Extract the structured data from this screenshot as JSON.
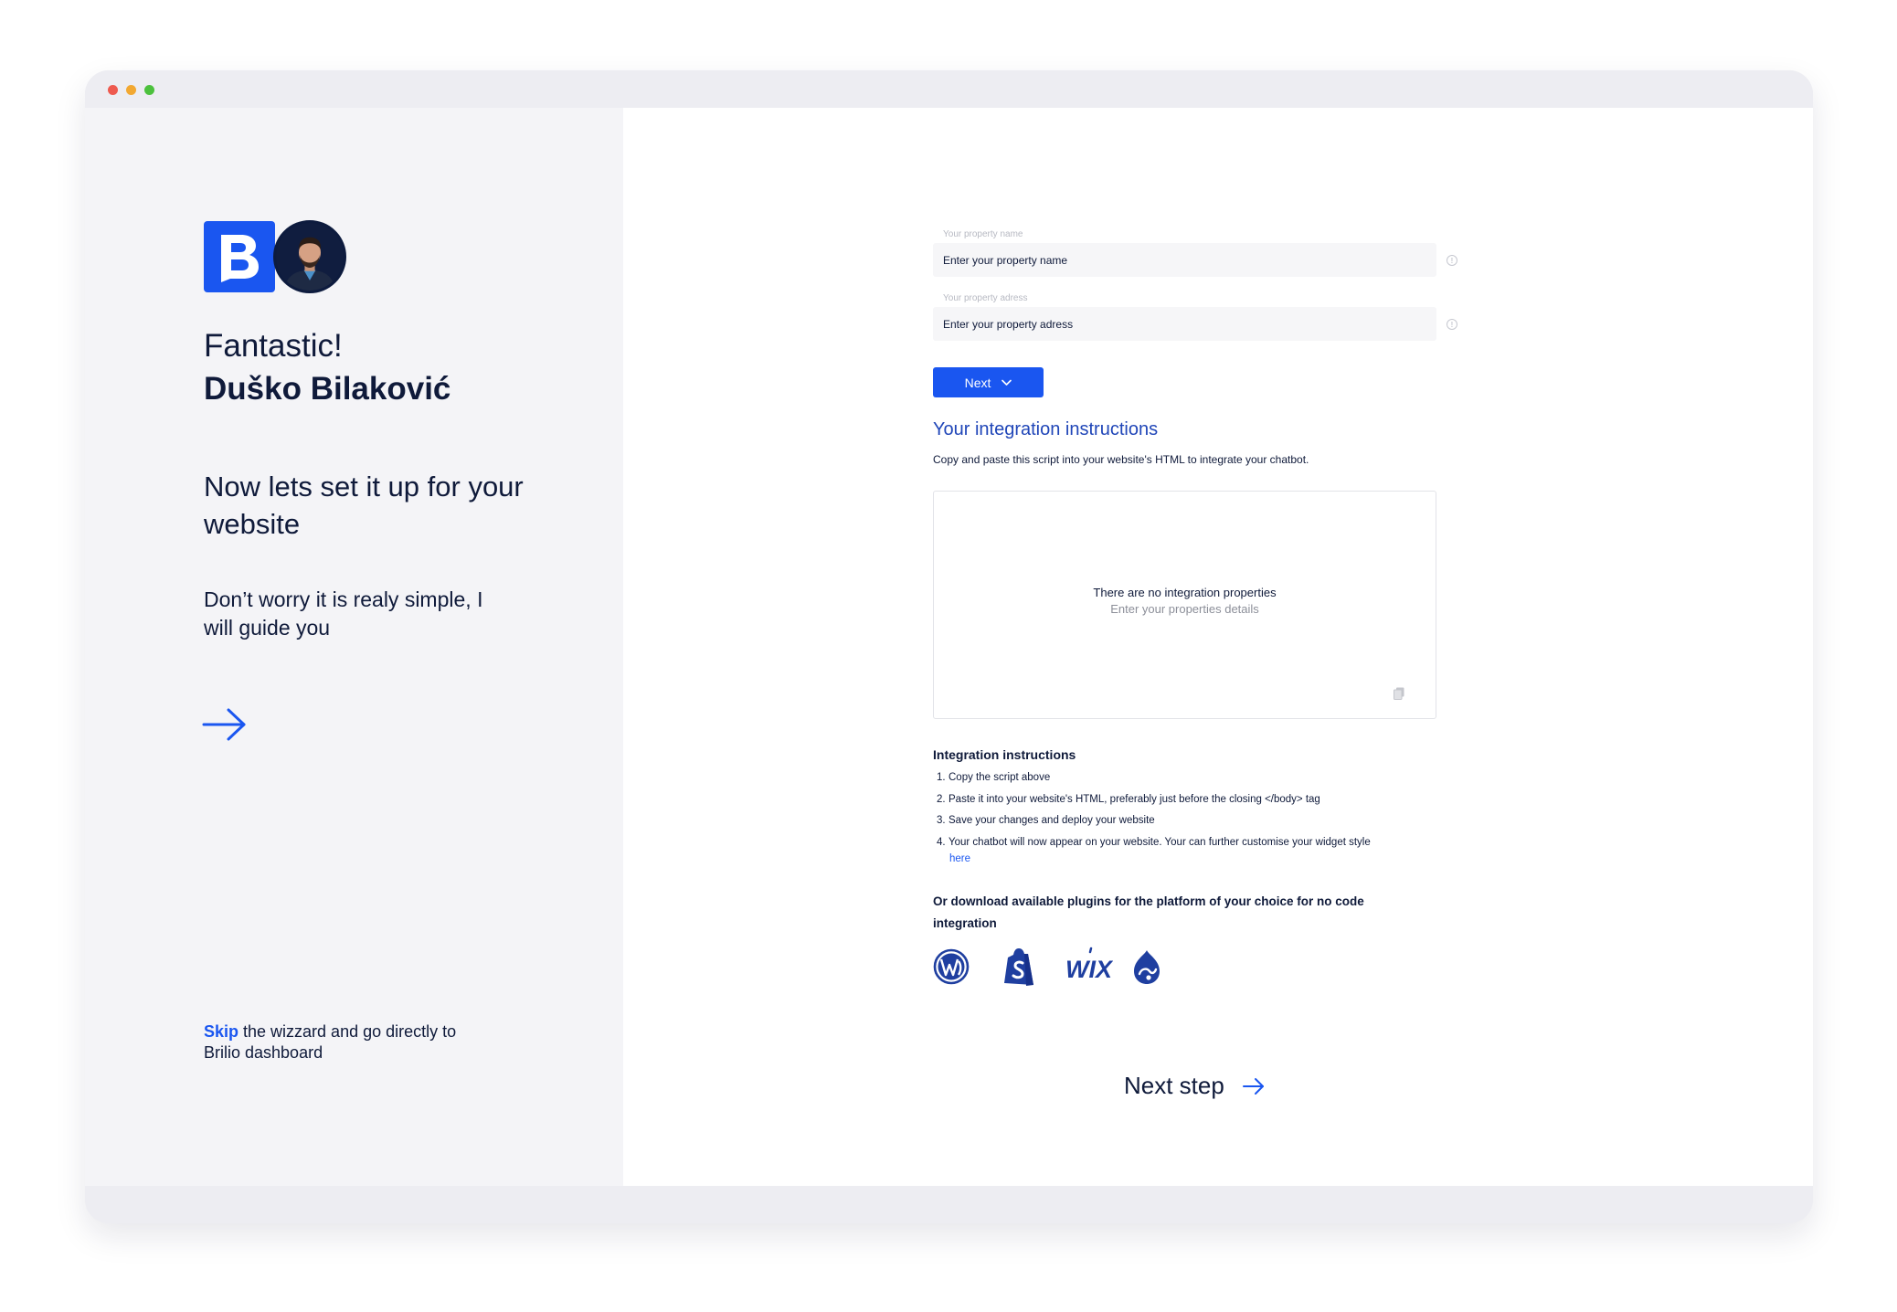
{
  "colors": {
    "accent": "#1a56f0",
    "heading_blue": "#2046b8",
    "text_dark": "#0f1a3a",
    "sidebar_bg": "#f4f4f7",
    "window_chrome": "#ededf2"
  },
  "sidebar": {
    "logo_icon": "brilio-logo",
    "avatar_icon": "user-avatar",
    "greeting": "Fantastic!",
    "user_name": "Duško Bilaković",
    "lead": "Now lets set it up for your website",
    "subtext": "Don’t worry it is realy simple, I will guide you",
    "arrow_icon": "arrow-right-icon",
    "skip_link": "Skip",
    "skip_text": " the wizzard and go directly to Brilio dashboard"
  },
  "form": {
    "property_name_label": "Your property name",
    "property_name_placeholder": "Enter your property name",
    "property_address_label": "Your property adress",
    "property_address_placeholder": "Enter your property adress",
    "next_button": "Next"
  },
  "integration": {
    "title": "Your integration instructions",
    "description": "Copy and paste this script into your website's HTML to integrate your chatbot.",
    "empty_title": "There are no integration properties",
    "empty_subtitle": "Enter your properties details",
    "instructions_title": "Integration instructions",
    "steps": [
      {
        "n": "1.",
        "text": "Copy the script above"
      },
      {
        "n": "2.",
        "text": "Paste it into your website's HTML, preferably just before the closing </body> tag"
      },
      {
        "n": "3.",
        "text": "Save your changes and deploy your website"
      },
      {
        "n": "4.",
        "text": "Your chatbot will now appear on your website. Your can further customise your widget style"
      }
    ],
    "here_link": "here",
    "plugins_text": "Or download available plugins for the platform of your choice for no code integration",
    "plugins": [
      "wordpress-icon",
      "shopify-icon",
      "wix-icon",
      "drupal-icon"
    ]
  },
  "footer": {
    "next_step": "Next step"
  }
}
